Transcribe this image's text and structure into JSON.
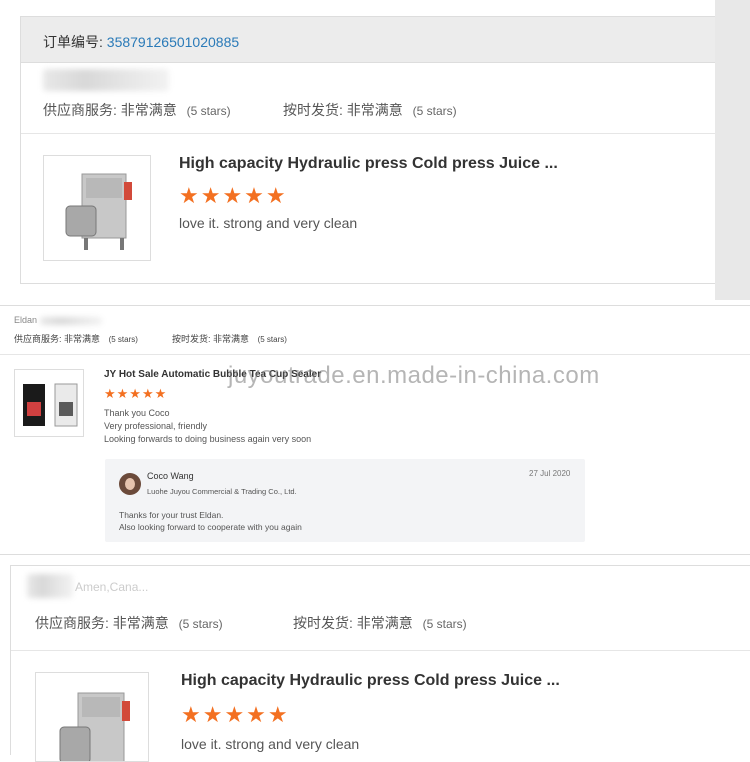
{
  "panel1": {
    "order_label": "订单编号:",
    "order_number": "35879126501020885",
    "supplier_service_label": "供应商服务:",
    "supplier_service_value": "非常满意",
    "supplier_service_stars": "(5 stars)",
    "ontime_label": "按时发货:",
    "ontime_value": "非常满意",
    "ontime_stars": "(5 stars)",
    "product_title": "High capacity Hydraulic press Cold press Juice ...",
    "stars": "★★★★★",
    "review": "love it. strong and very clean",
    "rating": 5
  },
  "panel2": {
    "buyer_name": "Eldan",
    "supplier_service_label": "供应商服务:",
    "supplier_service_value": "非常满意",
    "supplier_service_stars": "(5 stars)",
    "ontime_label": "按时发货:",
    "ontime_value": "非常满意",
    "ontime_stars": "(5 stars)",
    "product_title": "JY Hot Sale Automatic Bubble Tea Cup Sealer",
    "stars": "★★★★★",
    "review_lines": [
      "Thank you Coco",
      "Very professional, friendly",
      "Looking forwards to doing business again very soon"
    ],
    "rating": 5,
    "reply": {
      "name": "Coco Wang",
      "date": "27 Jul 2020",
      "company": "Luohe Juyou Commercial & Trading Co., Ltd.",
      "lines": [
        "Thanks for your trust Eldan.",
        "Also looking forward to cooperate with you again"
      ]
    }
  },
  "watermark": "juyoutrade.en.made-in-china.com",
  "panel3": {
    "buyer_name": "Amen,Cana...",
    "supplier_service_label": "供应商服务:",
    "supplier_service_value": "非常满意",
    "supplier_service_stars": "(5 stars)",
    "ontime_label": "按时发货:",
    "ontime_value": "非常满意",
    "ontime_stars": "(5 stars)",
    "product_title": "High capacity Hydraulic press Cold press Juice ...",
    "stars": "★★★★★",
    "review": "love it. strong and very clean",
    "rating": 5
  },
  "colors": {
    "star": "#f37021",
    "link": "#2a7ab8",
    "header_bg": "#ececec"
  }
}
